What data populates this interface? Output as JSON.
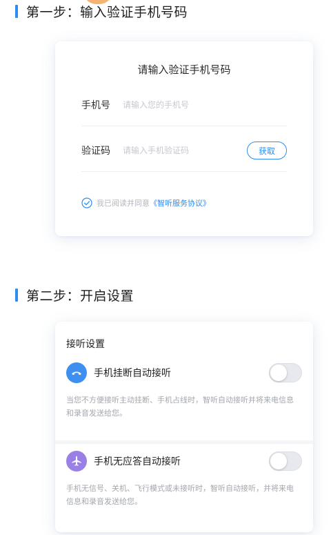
{
  "step1": {
    "heading": "第一步：输入验证手机号码",
    "card_title": "请输入验证手机号码",
    "phone_label": "手机号",
    "phone_placeholder": "请输入您的手机号",
    "phone_value": "",
    "code_label": "验证码",
    "code_placeholder": "请输入手机验证码",
    "code_value": "",
    "get_button": "获取",
    "agree_text": "我已阅读并同意",
    "agree_link": "《智听服务协议》",
    "agree_checked": true
  },
  "step2": {
    "heading": "第二步：开启设置",
    "card_title": "接听设置",
    "settings": [
      {
        "icon": "phone-hangup-icon",
        "label": "手机挂断自动接听",
        "enabled": false,
        "description": "当您不方便接听主动挂断、手机占线时，智听自动接听并将来电信息和录音发送给您。"
      },
      {
        "icon": "airplane-icon",
        "label": "手机无应答自动接听",
        "enabled": false,
        "description": "手机无信号、关机、飞行模式或未接听时，智听自动接听，并将来电信息和录音发送给您。"
      }
    ]
  },
  "colors": {
    "accent": "#2d8cf0",
    "hangup_icon_bg": "#3e8ff0",
    "plane_icon_bg": "#9a7fe6",
    "placeholder": "#c5c8ce",
    "desc_text": "#a3a7ae"
  }
}
